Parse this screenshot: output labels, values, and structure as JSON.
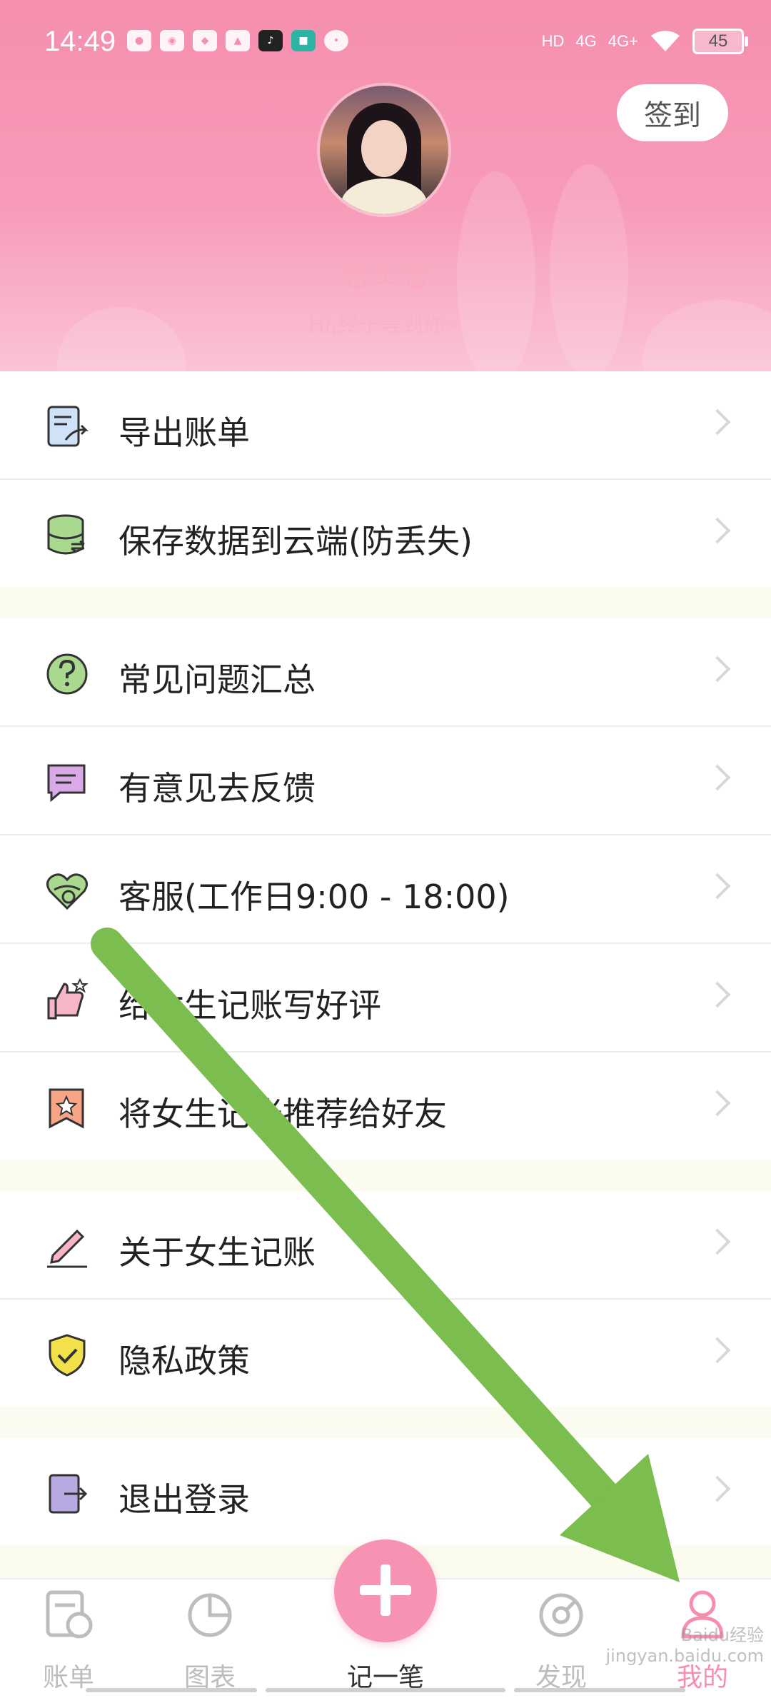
{
  "status_bar": {
    "time": "14:49",
    "battery": "45",
    "network_1": "4G",
    "network_2": "4G+"
  },
  "header": {
    "signin_label": "签到",
    "user_name": "장조영",
    "greeting": "Hi,终于等到你~"
  },
  "menu": {
    "group1": [
      {
        "label": "导出账单",
        "icon": "export-bill-icon"
      },
      {
        "label": "保存数据到云端(防丢失)",
        "icon": "cloud-database-icon"
      }
    ],
    "group2": [
      {
        "label": "常见问题汇总",
        "icon": "question-icon"
      },
      {
        "label": "有意见去反馈",
        "icon": "feedback-icon"
      },
      {
        "label": "客服(工作日9:00 - 18:00)",
        "icon": "customer-service-icon"
      },
      {
        "label": "给女生记账写好评",
        "icon": "thumbs-up-icon"
      },
      {
        "label": "将女生记账推荐给好友",
        "icon": "recommend-star-icon"
      }
    ],
    "group3": [
      {
        "label": "关于女生记账",
        "icon": "pencil-icon"
      },
      {
        "label": "隐私政策",
        "icon": "shield-check-icon"
      }
    ],
    "group4": [
      {
        "label": "退出登录",
        "icon": "logout-icon"
      }
    ]
  },
  "tabbar": {
    "tabs": [
      {
        "label": "账单",
        "icon": "bill-icon"
      },
      {
        "label": "图表",
        "icon": "chart-icon"
      },
      {
        "label": "记一笔",
        "icon": "plus-icon"
      },
      {
        "label": "发现",
        "icon": "discover-icon"
      },
      {
        "label": "我的",
        "icon": "user-icon"
      }
    ],
    "active": "我的"
  },
  "colors": {
    "brand_pink": "#f58fae",
    "arrow_green": "#7cbd4f",
    "background": "#fbfbef"
  },
  "watermark": "Baidu经验 jingyan.baidu.com"
}
